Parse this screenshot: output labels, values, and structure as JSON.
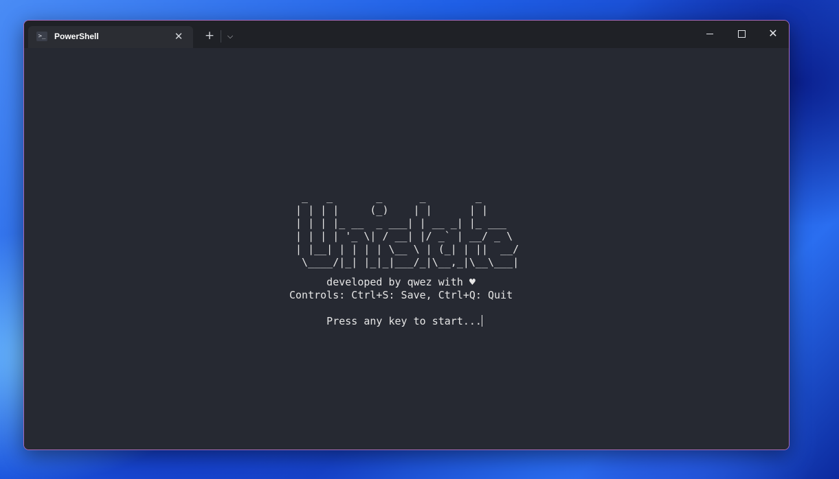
{
  "window": {
    "tab_title": "PowerShell",
    "tab_icon": "powershell-icon",
    "tab_close_glyph": "✕",
    "new_tab_glyph": "+",
    "dropdown_glyph": "⌵",
    "close_glyph": "✕"
  },
  "terminal": {
    "ascii_art": "  _   _       _      _        _\n | | | |     (_)    | |      | |\n | | | |_ __  _ ___| | __ _| |_ ___\n | | | | '_ \\| / __| |/ _` | __/ _ \\\n | |__| | | | | \\__ \\ | (_| | ||  __/\n  \\____/|_| |_|_|___/_|\\__,_|\\__\\___|",
    "developed_line": "      developed by qwez with ♥",
    "controls_line": "Controls: Ctrl+S: Save, Ctrl+Q: Quit",
    "prompt_line": "      Press any key to start..."
  }
}
